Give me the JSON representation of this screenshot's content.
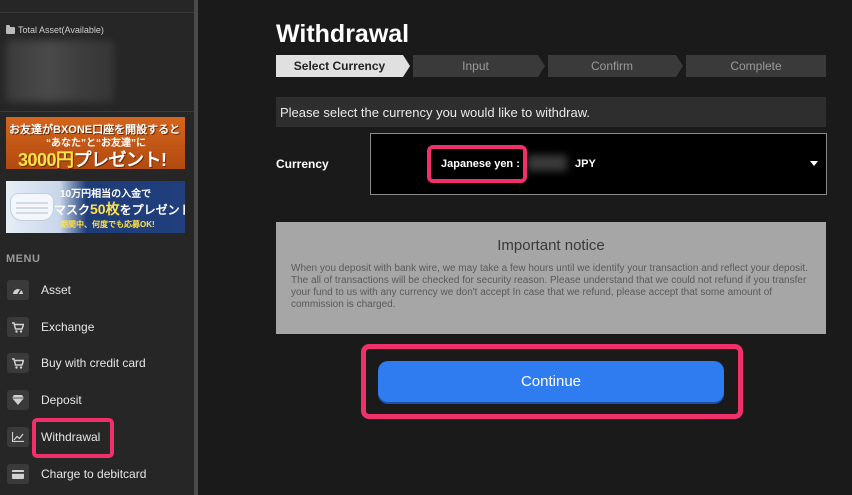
{
  "sidebar": {
    "total_asset_label": "Total Asset(Available)",
    "banner1": {
      "line1": "お友達がBXONE口座を開設すると",
      "line2": "“あなた”と“お友達”に",
      "amount": "3000円",
      "suffix": "プレゼント!"
    },
    "banner2": {
      "line1": "10万円相当の入金で",
      "line2_a": "マスク",
      "line2_b": "50枚",
      "line2_c": "をプレゼント!",
      "line3": "期間中、何度でも応募OK!"
    },
    "menu_title": "MENU",
    "items": [
      {
        "label": "Asset",
        "icon": "speedometer-icon"
      },
      {
        "label": "Exchange",
        "icon": "cart-icon"
      },
      {
        "label": "Buy with credit card",
        "icon": "cart-icon"
      },
      {
        "label": "Deposit",
        "icon": "diamond-icon"
      },
      {
        "label": "Withdrawal",
        "icon": "chart-icon"
      },
      {
        "label": "Charge to debitcard",
        "icon": "card-icon"
      }
    ]
  },
  "main": {
    "title": "Withdrawal",
    "steps": [
      "Select Currency",
      "Input",
      "Confirm",
      "Complete"
    ],
    "instruction": "Please select the currency you would like to withdraw.",
    "currency_label": "Currency",
    "currency": {
      "name": "Japanese yen :",
      "code": "JPY"
    },
    "notice": {
      "title": "Important notice",
      "body": "When you deposit with bank wire, we may take a few hours until we identify your transaction and reflect your deposit. The all of transactions will be checked for security reason. Please understand that we could not refund if you transfer your fund to us with any currency we don't accept In case that we refund, please accept that some amount of commission is charged."
    },
    "continue_label": "Continue"
  },
  "colors": {
    "accent_blue": "#2f7cf0",
    "highlight_pink": "#f0306a"
  }
}
